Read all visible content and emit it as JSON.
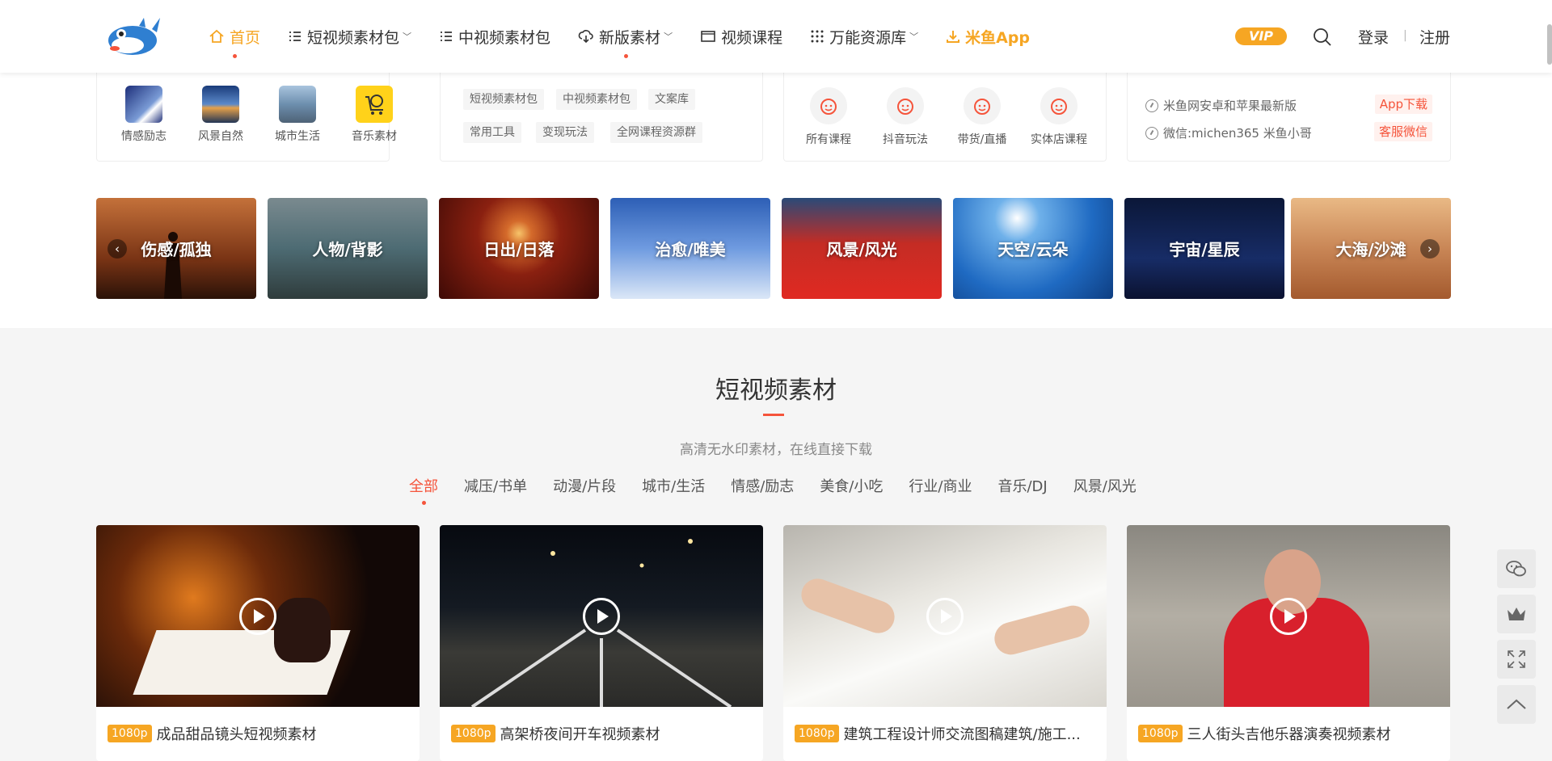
{
  "header": {
    "nav": [
      {
        "label": "首页",
        "icon": "home-icon",
        "active": true,
        "caret": false,
        "dot": true
      },
      {
        "label": "短视频素材包",
        "icon": "list-icon",
        "active": false,
        "caret": true,
        "dot": false
      },
      {
        "label": "中视频素材包",
        "icon": "list-icon",
        "active": false,
        "caret": false,
        "dot": false
      },
      {
        "label": "新版素材",
        "icon": "cloud-download-icon",
        "active": false,
        "caret": true,
        "dot": true
      },
      {
        "label": "视频课程",
        "icon": "monitor-icon",
        "active": false,
        "caret": false,
        "dot": false
      },
      {
        "label": "万能资源库",
        "icon": "grid-icon",
        "active": false,
        "caret": true,
        "dot": false
      },
      {
        "label": "米鱼App",
        "icon": "download-icon",
        "active": false,
        "caret": false,
        "dot": false
      }
    ],
    "vip": "VIP",
    "login": "登录",
    "separator": "|",
    "register": "注册",
    "accent": "#f6a623",
    "red": "#f5543b"
  },
  "panels": {
    "categories": [
      {
        "label": "情感励志"
      },
      {
        "label": "风景自然"
      },
      {
        "label": "城市生活"
      },
      {
        "label": "音乐素材"
      }
    ],
    "tags": [
      "短视频素材包",
      "中视频素材包",
      "文案库",
      "常用工具",
      "变现玩法",
      "全网课程资源群"
    ],
    "courses": [
      "所有课程",
      "抖音玩法",
      "带货/直播",
      "实体店课程"
    ],
    "info": [
      {
        "text": "米鱼网安卓和苹果最新版",
        "button": "App下载"
      },
      {
        "text": "微信:michen365 米鱼小哥",
        "button": "客服微信"
      }
    ]
  },
  "banners": [
    "伤感/孤独",
    "人物/背影",
    "日出/日落",
    "治愈/唯美",
    "风景/风光",
    "天空/云朵",
    "宇宙/星辰",
    "大海/沙滩"
  ],
  "section": {
    "title": "短视频素材",
    "subtitle": "高清无水印素材，在线直接下载",
    "filters": [
      "全部",
      "减压/书单",
      "动漫/片段",
      "城市/生活",
      "情感/励志",
      "美食/小吃",
      "行业/商业",
      "音乐/DJ",
      "风景/风光"
    ],
    "active_filter": "全部"
  },
  "cards": [
    {
      "res": "1080p",
      "title": "成品甜品镜头短视频素材"
    },
    {
      "res": "1080p",
      "title": "高架桥夜间开车视频素材"
    },
    {
      "res": "1080p",
      "title": "建筑工程设计师交流图稿建筑/施工..."
    },
    {
      "res": "1080p",
      "title": "三人街头吉他乐器演奏视频素材"
    }
  ],
  "side_tools": [
    "wechat-icon",
    "crown-icon",
    "fullscreen-icon",
    "back-to-top-icon"
  ]
}
